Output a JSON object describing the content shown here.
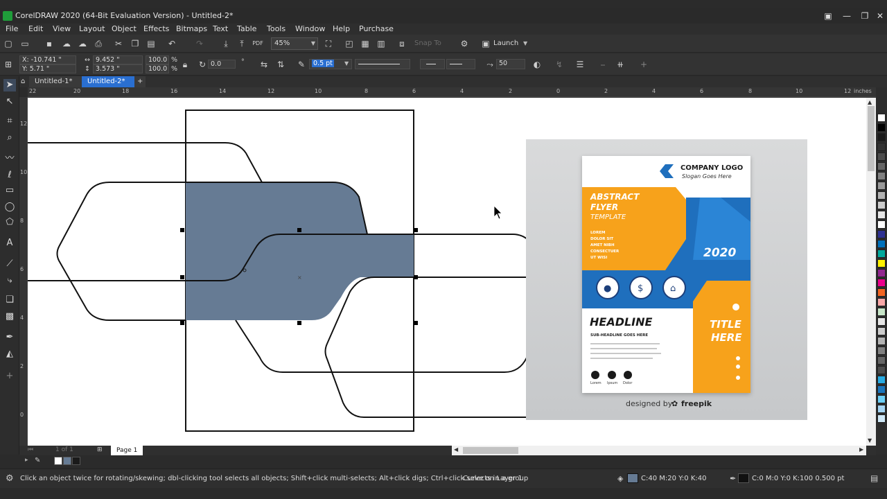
{
  "window": {
    "title": "CorelDRAW 2020 (64-Bit Evaluation Version) - Untitled-2*",
    "min": "—",
    "max": "❐",
    "close": "✕"
  },
  "menu": [
    "File",
    "Edit",
    "View",
    "Layout",
    "Object",
    "Effects",
    "Bitmaps",
    "Text",
    "Table",
    "Tools",
    "Window",
    "Help",
    "Purchase"
  ],
  "toolbar": {
    "zoom": "45%",
    "snap_to": "Snap To",
    "launch": "Launch"
  },
  "propbar": {
    "x": "X: -10.741 \"",
    "y": "Y: 5.71 \"",
    "w": "9.452 \"",
    "h": "3.573 \"",
    "scale_w": "100.0",
    "scale_h": "100.0",
    "pct": "%",
    "rotation": "0.0",
    "outline_width": "0.5 pt",
    "smoothing": "50"
  },
  "doc_tabs": [
    {
      "label": "Untitled-1*",
      "active": false
    },
    {
      "label": "Untitled-2*",
      "active": true
    }
  ],
  "ruler": {
    "unit": "inches",
    "ticks": [
      "22",
      "20",
      "18",
      "16",
      "14",
      "12",
      "10",
      "8",
      "6",
      "4",
      "2",
      "0",
      "2",
      "4",
      "6",
      "8",
      "10",
      "12"
    ],
    "vticks": [
      "12",
      "10",
      "8",
      "6",
      "4",
      "2",
      "0"
    ]
  },
  "page_nav": {
    "counter": "1 of 1",
    "page_tab": "Page 1"
  },
  "flyer": {
    "company_logo": "COMPANY LOGO",
    "slogan": "Slogan Goes Here",
    "abstract_line1": "ABSTRACT",
    "abstract_line2": "FLYER",
    "template": "TEMPLATE",
    "lorem_lines": [
      "LOREM",
      "DOLOR SIT",
      "AMET NIBH",
      "CONSECTUER",
      "UT WISI"
    ],
    "year": "2020",
    "headline": "HEADLINE",
    "subheadline": "SUB-HEADLINE GOES HERE",
    "title1": "TITLE",
    "title2": "HERE",
    "social_labels": [
      "Lorem",
      "Ipsum",
      "Dolor"
    ],
    "credit": "designed by",
    "credit_brand": "freepik"
  },
  "status": {
    "hint": "Click an object twice for rotating/skewing; dbl-clicking tool selects all objects; Shift+click multi-selects; Alt+click digs; Ctrl+click selects in a group",
    "object": "Curve on Layer 1",
    "fill": "C:40 M:20 Y:0 K:40",
    "outline": "C:0 M:0 Y:0 K:100  0.500 pt"
  },
  "colors": {
    "shape_fill": "#667b94",
    "orange": "#f7a21b",
    "blue": "#1f6fbd",
    "dark_blue": "#1d3f7a"
  },
  "palette": [
    "#ffffff",
    "#000000",
    "#1a1a1a",
    "#333333",
    "#4d4d4d",
    "#666666",
    "#808080",
    "#999999",
    "#b3b3b3",
    "#cccccc",
    "#e6e6e6",
    "#ffffff",
    "#2e3192",
    "#0071bc",
    "#00a99d",
    "#39b54a",
    "#fff200",
    "#f7931e",
    "#ed1c24",
    "#ec008c",
    "#92278f",
    "#8b5e3c",
    "#f26522",
    "#f9a8a8",
    "#c8e6c9",
    "#b3e5fc",
    "#29abe2",
    "#1b75bb",
    "#6dcff6",
    "#a5d4f3",
    "#cfe8f7"
  ]
}
